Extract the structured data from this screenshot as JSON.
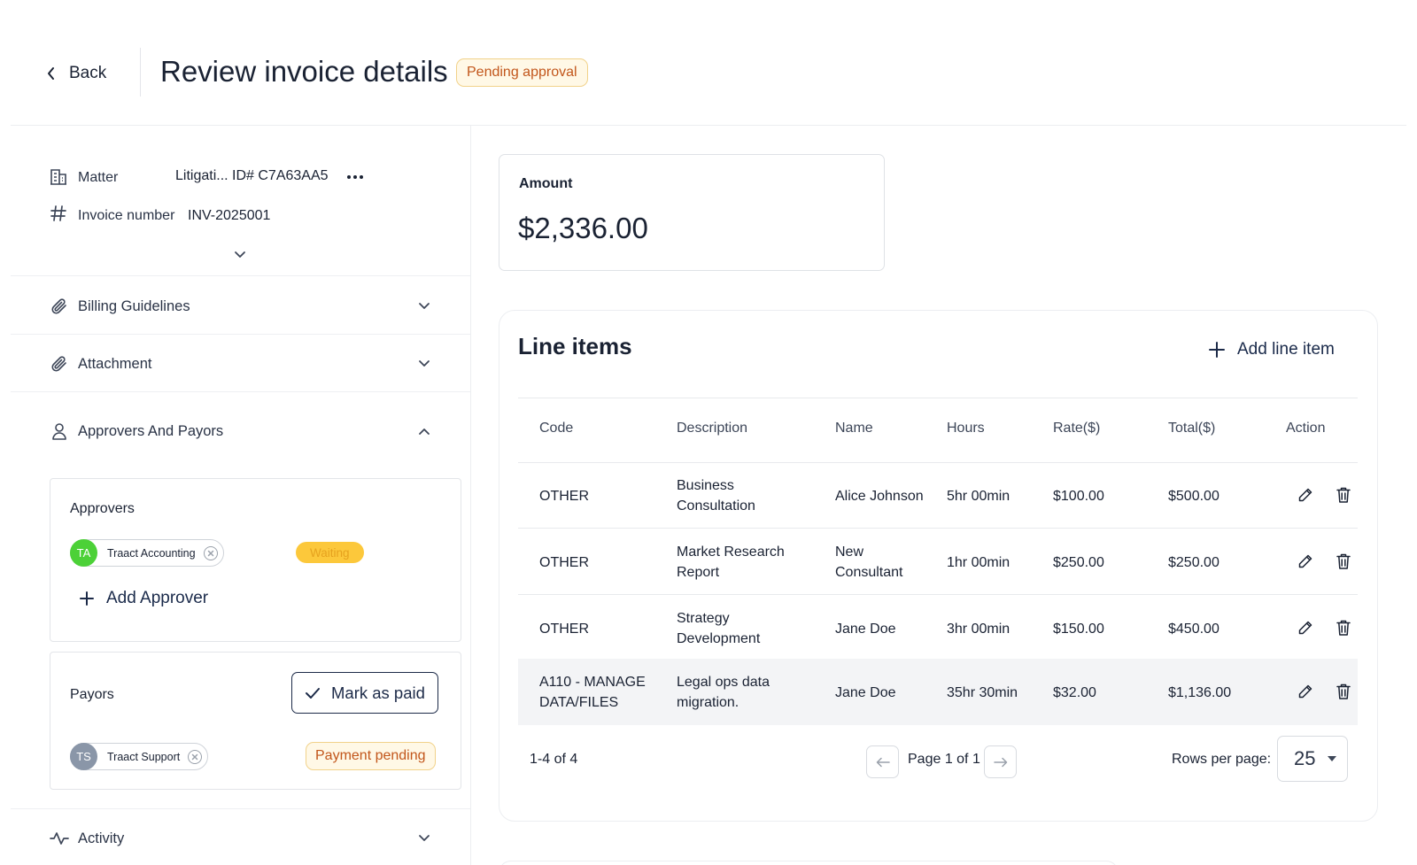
{
  "header": {
    "back_label": "Back",
    "title": "Review invoice details",
    "status": "Pending approval"
  },
  "details": {
    "matter_label": "Matter",
    "matter_value": "Litigati... ID# C7A63AA5",
    "invoice_number_label": "Invoice number",
    "invoice_number_value": "INV-2025001"
  },
  "sections": {
    "billing_guidelines": "Billing Guidelines",
    "attachment": "Attachment",
    "approvers_and_payors": "Approvers And Payors",
    "activity": "Activity"
  },
  "approvers": {
    "title": "Approvers",
    "items": [
      {
        "initials": "TA",
        "name": "Traact Accounting",
        "status": "Waiting",
        "avatar_color": "#4cd137"
      }
    ],
    "add_label": "Add Approver"
  },
  "payors": {
    "title": "Payors",
    "mark_paid_label": "Mark as paid",
    "items": [
      {
        "initials": "TS",
        "name": "Traact Support",
        "status": "Payment pending",
        "avatar_color": "#8a96a8"
      }
    ]
  },
  "amount": {
    "label": "Amount",
    "value": "$2,336.00"
  },
  "line_items": {
    "title": "Line items",
    "add_label": "Add line item",
    "columns": [
      "Code",
      "Description",
      "Name",
      "Hours",
      "Rate($)",
      "Total($)",
      "Action"
    ],
    "rows": [
      {
        "code": [
          "OTHER"
        ],
        "description": [
          "Business",
          "Consultation"
        ],
        "name": [
          "Alice Johnson"
        ],
        "hours": "5hr 00min",
        "rate": "$100.00",
        "total": "$500.00"
      },
      {
        "code": [
          "OTHER"
        ],
        "description": [
          "Market Research",
          "Report"
        ],
        "name": [
          "New",
          "Consultant"
        ],
        "hours": "1hr 00min",
        "rate": "$250.00",
        "total": "$250.00"
      },
      {
        "code": [
          "OTHER"
        ],
        "description": [
          "Strategy",
          "Development"
        ],
        "name": [
          "Jane Doe"
        ],
        "hours": "3hr 00min",
        "rate": "$150.00",
        "total": "$450.00"
      },
      {
        "code": [
          "A110 - MANAGE",
          "DATA/FILES"
        ],
        "description": [
          "Legal ops data",
          "migration."
        ],
        "name": [
          "Jane Doe"
        ],
        "hours": "35hr 30min",
        "rate": "$32.00",
        "total": "$1,136.00"
      }
    ],
    "range_text": "1-4 of 4",
    "page_text": "Page 1 of 1",
    "rows_per_page_label": "Rows per page:",
    "rows_per_page_value": "25"
  },
  "colors": {
    "brand_dark": "#1c2a48",
    "pending_text": "#c2561b",
    "pending_bg": "#fff8e6",
    "waiting_bg": "#fcc83b",
    "row_highlight": "#f3f4f6"
  },
  "icons": {
    "back": "chevron-left-icon",
    "matter": "building-icon",
    "invoice": "hash-icon",
    "more": "more-horizontal-icon",
    "expand": "chevron-down-icon",
    "collapse": "chevron-up-icon",
    "billing": "paperclip-icon",
    "attachment": "paperclip-icon",
    "person": "user-icon",
    "activity": "activity-icon",
    "add": "plus-icon",
    "check": "check-icon",
    "remove": "close-circle-icon",
    "edit": "pencil-icon",
    "delete": "trash-icon",
    "prev": "arrow-left-icon",
    "next": "arrow-right-icon"
  }
}
